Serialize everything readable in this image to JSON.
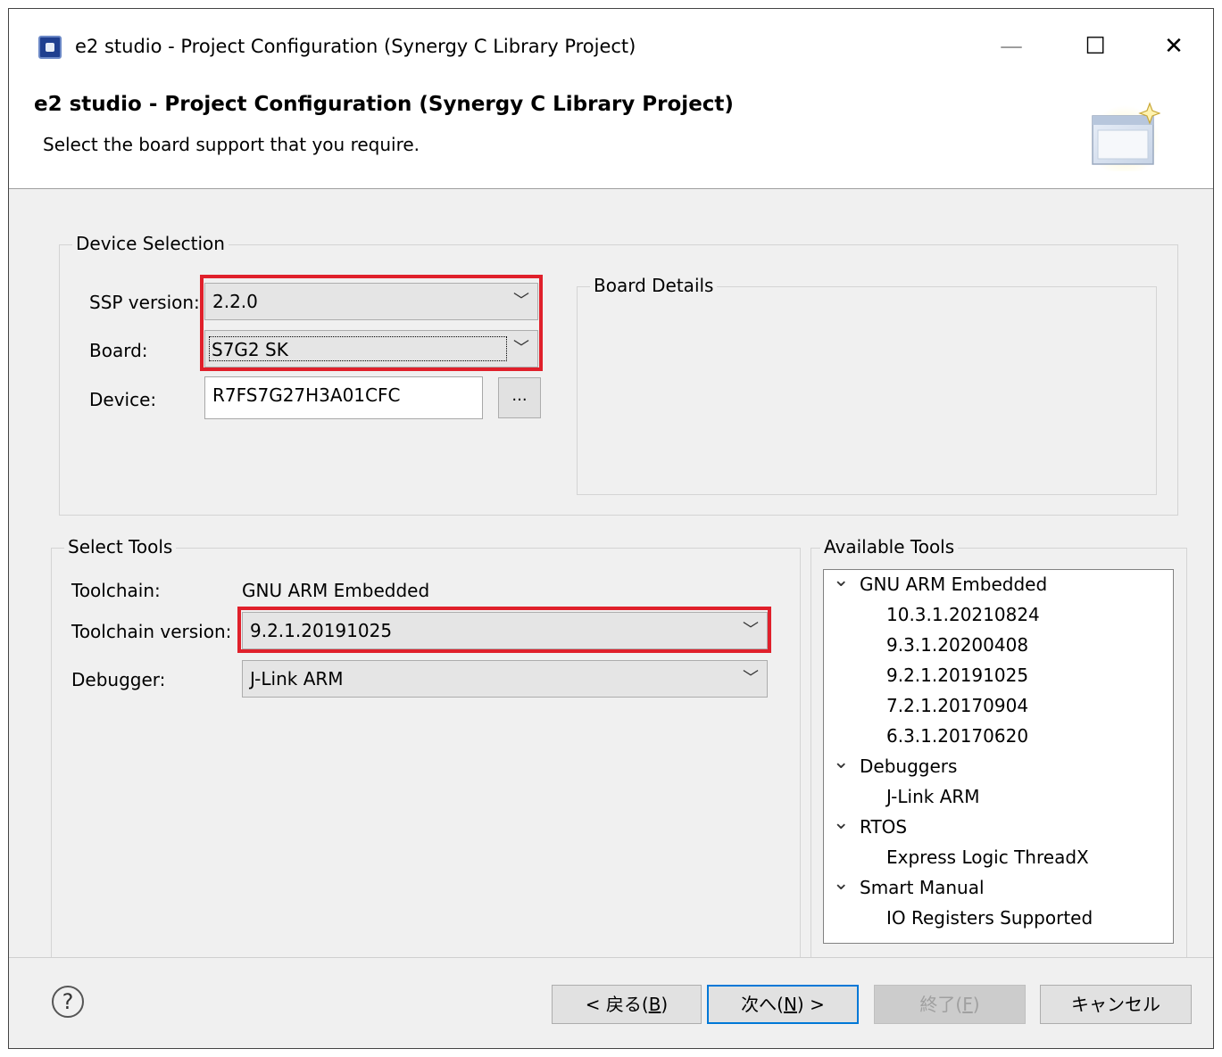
{
  "window": {
    "title": "e2 studio - Project Configuration  (Synergy C Library Project)",
    "min_glyph": "—",
    "max_glyph": "☐",
    "close_glyph": "✕"
  },
  "header": {
    "title": "e2 studio - Project Configuration  (Synergy C Library Project)",
    "description": "Select the board support that you require."
  },
  "device_selection": {
    "group_label": "Device Selection",
    "ssp_label": "SSP version:",
    "ssp_value": "2.2.0",
    "board_label": "Board:",
    "board_value": "S7G2 SK",
    "device_label": "Device:",
    "device_value": "R7FS7G27H3A01CFC",
    "browse_label": "..."
  },
  "board_details": {
    "group_label": "Board Details"
  },
  "select_tools": {
    "group_label": "Select Tools",
    "toolchain_label": "Toolchain:",
    "toolchain_value": "GNU ARM Embedded",
    "toolchain_version_label": "Toolchain version:",
    "toolchain_version_value": "9.2.1.20191025",
    "debugger_label": "Debugger:",
    "debugger_value": "J-Link ARM"
  },
  "available_tools": {
    "group_label": "Available Tools",
    "tree": [
      {
        "label": "GNU ARM Embedded",
        "expandable": true
      },
      {
        "label": "10.3.1.20210824",
        "expandable": false
      },
      {
        "label": "9.3.1.20200408",
        "expandable": false
      },
      {
        "label": "9.2.1.20191025",
        "expandable": false
      },
      {
        "label": "7.2.1.20170904",
        "expandable": false
      },
      {
        "label": "6.3.1.20170620",
        "expandable": false
      },
      {
        "label": "Debuggers",
        "expandable": true
      },
      {
        "label": "J-Link ARM",
        "expandable": false
      },
      {
        "label": "RTOS",
        "expandable": true
      },
      {
        "label": "Express Logic ThreadX",
        "expandable": false
      },
      {
        "label": "Smart Manual",
        "expandable": true
      },
      {
        "label": "IO Registers Supported",
        "expandable": false
      }
    ]
  },
  "footer": {
    "help_glyph": "?",
    "back_pre": "< 戻る(",
    "back_key": "B",
    "back_post": ")",
    "next_pre": "次へ(",
    "next_key": "N",
    "next_post": ") >",
    "finish_pre": "終了(",
    "finish_key": "F",
    "finish_post": ")",
    "cancel_label": "キャンセル"
  },
  "colors": {
    "highlight": "#e0202b",
    "default_button_border": "#0078d7"
  },
  "icons": {
    "app": "e2-studio-icon",
    "chevron": "chevron-down-icon",
    "expand": "expand-arrow-icon",
    "help": "help-icon"
  }
}
